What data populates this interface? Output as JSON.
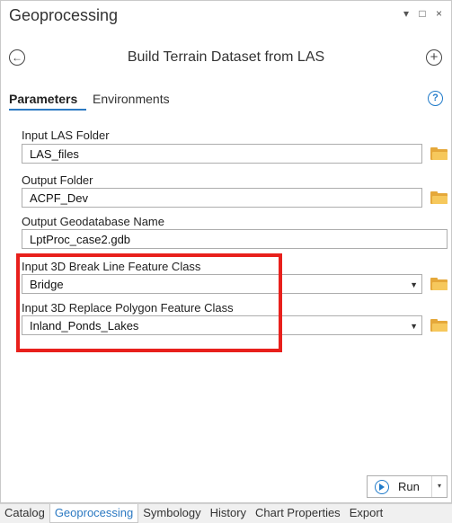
{
  "window": {
    "title": "Geoprocessing",
    "controls": "▾ □ ×"
  },
  "tool": {
    "title": "Build Terrain Dataset from LAS",
    "back_glyph": "←",
    "add_glyph": "+"
  },
  "tabs": {
    "parameters": "Parameters",
    "environments": "Environments",
    "help_glyph": "?"
  },
  "params": [
    {
      "label": "Input LAS Folder",
      "value": "LAS_files",
      "kind": "folder"
    },
    {
      "label": "Output Folder",
      "value": "ACPF_Dev",
      "kind": "folder"
    },
    {
      "label": "Output Geodatabase Name",
      "value": "LptProc_case2.gdb",
      "kind": "text"
    },
    {
      "label": "Input 3D Break Line Feature Class",
      "value": "Bridge",
      "kind": "dropdown-folder"
    },
    {
      "label": "Input 3D Replace Polygon Feature Class",
      "value": "Inland_Ponds_Lakes",
      "kind": "dropdown-folder"
    }
  ],
  "highlight_color": "#e8201c",
  "run_button": {
    "label": "Run",
    "arrow": "▾"
  },
  "bottom_tabs": [
    "Catalog",
    "Geoprocessing",
    "Symbology",
    "History",
    "Chart Properties",
    "Export"
  ],
  "active_bottom_tab": "Geoprocessing"
}
